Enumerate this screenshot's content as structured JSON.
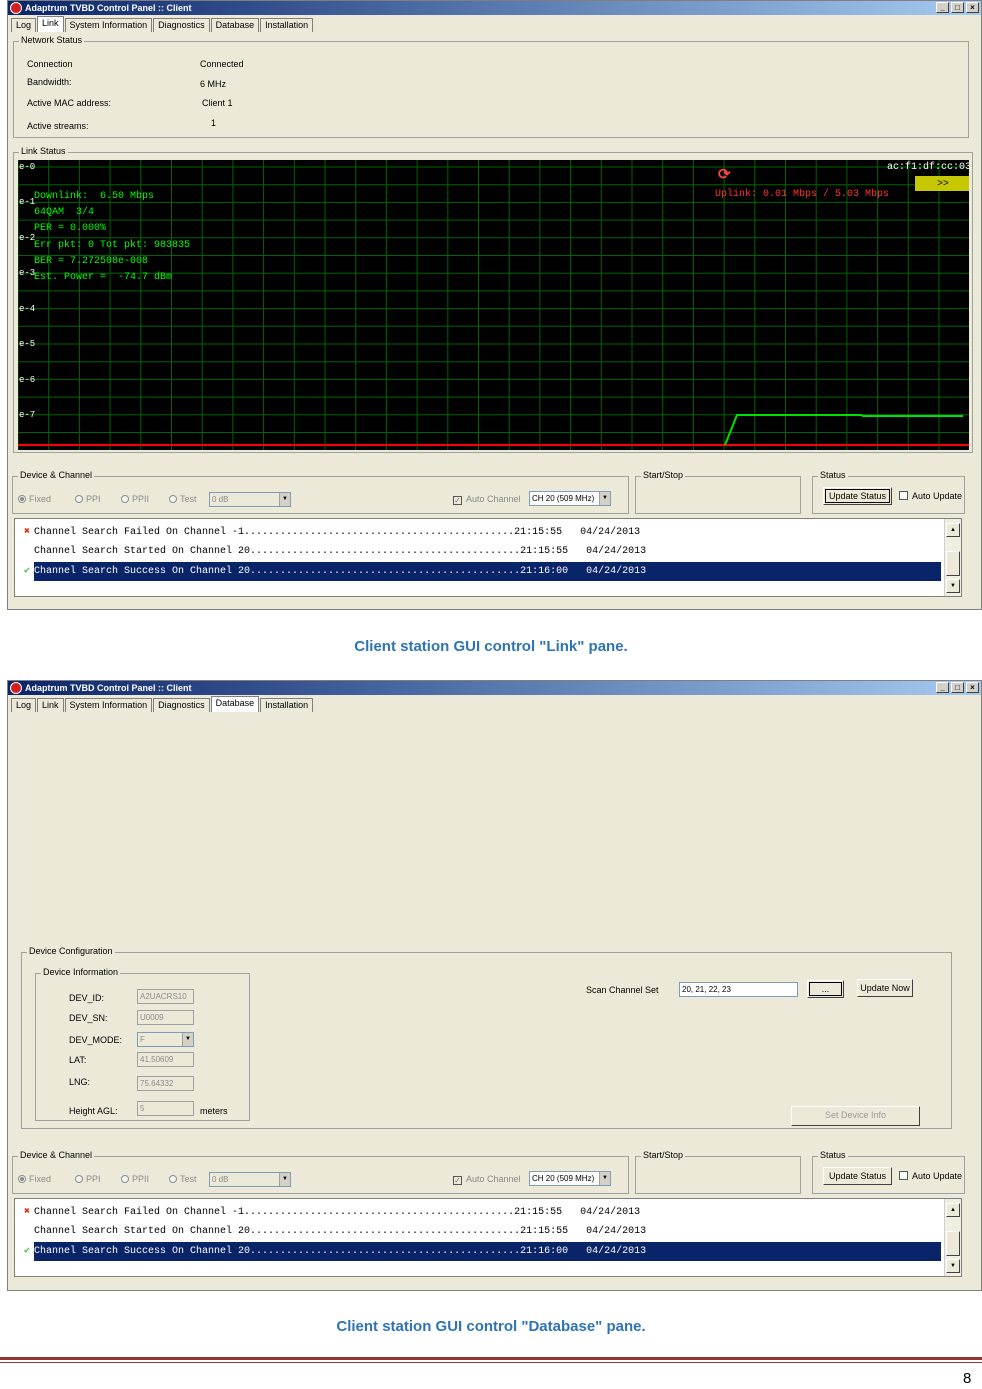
{
  "window": {
    "title": "Adaptrum TVBD Control Panel :: Client",
    "controls": [
      "_",
      "□",
      "×"
    ]
  },
  "tabs": [
    "Log",
    "Link",
    "System Information",
    "Diagnostics",
    "Database",
    "Installation"
  ],
  "link_pane": {
    "active_tab": "Link",
    "network_status": {
      "legend": "Network Status",
      "rows": [
        {
          "label": "Connection",
          "value": "Connected"
        },
        {
          "label": "Bandwidth:",
          "value": "6 MHz"
        },
        {
          "label": "Active MAC address:",
          "value": "Client 1"
        },
        {
          "label": "Active streams:",
          "value": "1"
        }
      ]
    },
    "link_status": {
      "legend": "Link Status",
      "y_ticks": [
        "e-0",
        "e-1",
        "e-2",
        "e-3",
        "e-4",
        "e-5",
        "e-6",
        "e-7"
      ],
      "downlink_lines": [
        "Downlink:  6.50 Mbps",
        "64QAM  3/4",
        "PER = 0.000%",
        "Err pkt: 0 Tot pkt: 983835",
        "BER = 7.272508e-008",
        "Est. Power =  -74.7 dBm"
      ],
      "uplink": "Uplink: 0.01 Mbps / 5.03 Mbps",
      "mac": "ac:f1:df:cc:03:63",
      "next_button": ">>",
      "colors": {
        "background": "#000000",
        "grid": "#006400",
        "text": "#00ff00",
        "uplink": "#ff3333",
        "trace": "#00e000",
        "baseline": "#ff0000",
        "mac_bg": "#c8c800"
      }
    }
  },
  "database_pane": {
    "active_tab": "Database",
    "device_configuration": {
      "legend": "Device Configuration",
      "device_information": {
        "legend": "Device Information",
        "fields": [
          {
            "label": "DEV_ID:",
            "value": "A2UACRS10"
          },
          {
            "label": "DEV_SN:",
            "value": "U0009"
          },
          {
            "label": "DEV_MODE:",
            "value": "F"
          },
          {
            "label": "LAT:",
            "value": "41.50609"
          },
          {
            "label": "LNG:",
            "value": "75.64332"
          },
          {
            "label": "Height AGL:",
            "value": "5",
            "unit": "meters"
          }
        ]
      },
      "scan_channel_set_label": "Scan Channel Set",
      "scan_channel_set_value": "20, 21, 22, 23",
      "browse_button": "...",
      "update_now_button": "Update Now",
      "set_device_info_button": "Set Device Info"
    }
  },
  "bottom": {
    "device_channel": {
      "legend": "Device & Channel",
      "radios": [
        "Fixed",
        "PPI",
        "PPII",
        "Test"
      ],
      "test_value": "0 dB",
      "auto_channel": "Auto Channel",
      "channel": "CH 20 (509 MHz)"
    },
    "start_stop": {
      "legend": "Start/Stop"
    },
    "status": {
      "legend": "Status",
      "update_button": "Update Status",
      "auto_update": "Auto Update"
    },
    "log": [
      {
        "icon": "✖",
        "text": "Channel Search Failed On Channel -1.............................................21:15:55   04/24/2013"
      },
      {
        "icon": "",
        "text": "Channel Search Started On Channel 20.............................................21:15:55   04/24/2013"
      },
      {
        "icon": "✔",
        "text": "Channel Search Success On Channel 20.............................................21:16:00   04/24/2013"
      }
    ]
  },
  "captions": {
    "link": "Client station GUI control \"Link\" pane.",
    "database": "Client station GUI control \"Database\" pane."
  },
  "page_number": "8",
  "rule_color": "#943634"
}
